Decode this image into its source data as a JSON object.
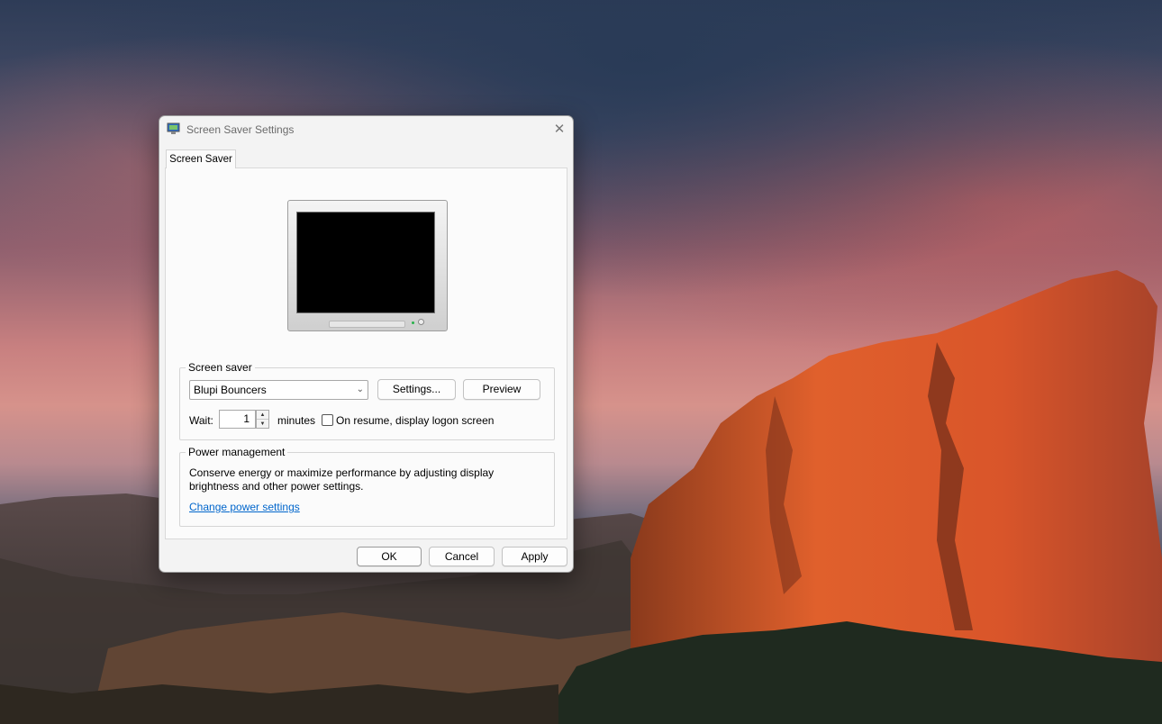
{
  "window": {
    "title": "Screen Saver Settings"
  },
  "tabs": [
    {
      "label": "Screen Saver",
      "active": true
    }
  ],
  "screen_saver_group": {
    "label": "Screen saver",
    "selected": "Blupi Bouncers",
    "settings_button": "Settings...",
    "preview_button": "Preview",
    "wait_label": "Wait:",
    "wait_value": "1",
    "minutes_label": "minutes",
    "resume_checkbox_label": "On resume, display logon screen",
    "resume_checked": false
  },
  "power_group": {
    "label": "Power management",
    "description_line1": "Conserve energy or maximize performance by adjusting display",
    "description_line2": "brightness and other power settings.",
    "link": "Change power settings"
  },
  "footer": {
    "ok": "OK",
    "cancel": "Cancel",
    "apply": "Apply"
  },
  "icons": {
    "title": "screen-saver-monitor-icon",
    "close": "close-icon",
    "dropdown": "chevron-down-icon",
    "spin_up": "spin-up-arrow-icon",
    "spin_down": "spin-down-arrow-icon"
  },
  "colors": {
    "link": "#0066cc",
    "dialog_bg": "#f3f3f3",
    "panel_bg": "#fbfbfb"
  }
}
